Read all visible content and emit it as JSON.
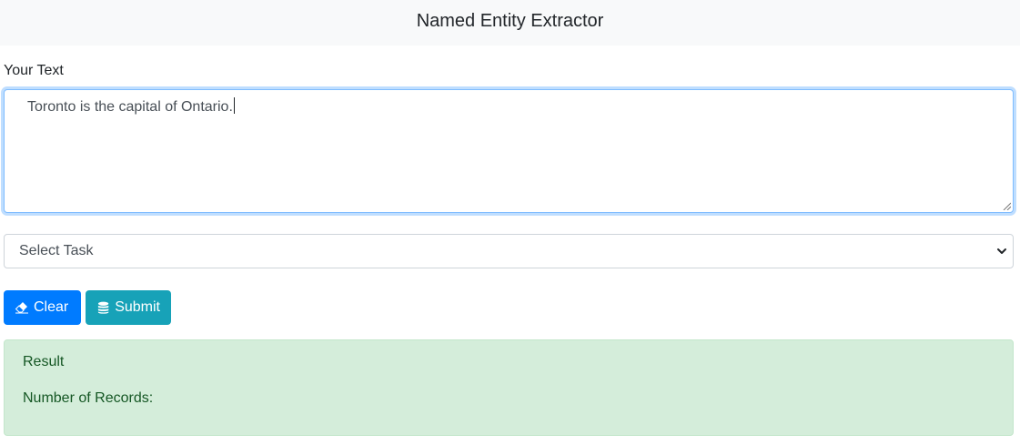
{
  "header": {
    "title": "Named Entity Extractor"
  },
  "form": {
    "text_label": "Your Text",
    "text_value": "Toronto is the capital of Ontario.",
    "task_select": {
      "selected": "Select Task"
    },
    "clear_label": "Clear",
    "submit_label": "Submit"
  },
  "result": {
    "title": "Result",
    "records_label": "Number of Records:"
  },
  "icons": {
    "clear": "eraser-icon",
    "submit": "database-icon",
    "select": "chevron-down-icon"
  },
  "colors": {
    "primary": "#007bff",
    "info": "#17a2b8",
    "success_bg": "#d4edda",
    "success_text": "#155724"
  }
}
